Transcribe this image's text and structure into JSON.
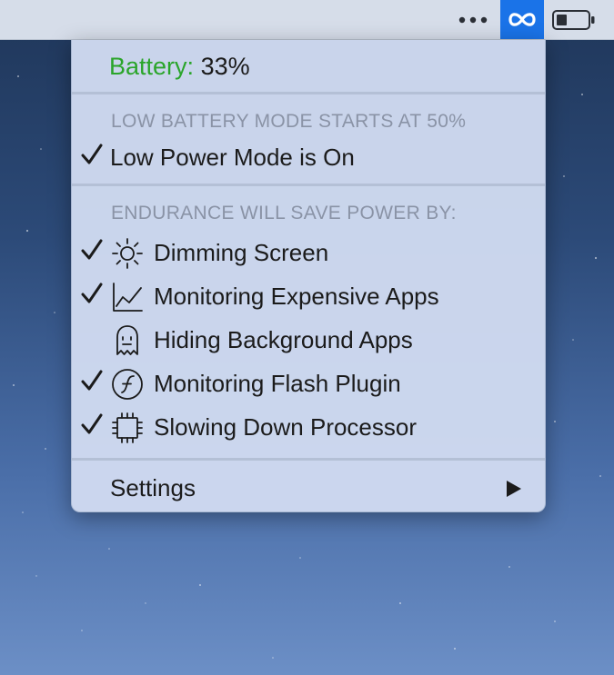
{
  "menubar": {
    "dots_icon": "ellipsis-icon",
    "endurance_icon": "infinity-icon",
    "battery_icon": "battery-icon",
    "accent_color": "#1a73e8"
  },
  "menu": {
    "battery_label": "Battery:",
    "battery_value": "33%",
    "low_battery_header": "LOW BATTERY MODE STARTS AT 50%",
    "low_power_item": {
      "label": "Low Power Mode is On",
      "checked": true
    },
    "savings_header": "ENDURANCE WILL SAVE POWER BY:",
    "items": [
      {
        "label": "Dimming Screen",
        "checked": true,
        "icon": "sun-icon"
      },
      {
        "label": "Monitoring Expensive Apps",
        "checked": true,
        "icon": "chart-line-icon"
      },
      {
        "label": "Hiding Background Apps",
        "checked": false,
        "icon": "ghost-icon"
      },
      {
        "label": "Monitoring Flash Plugin",
        "checked": true,
        "icon": "flash-icon"
      },
      {
        "label": "Slowing Down Processor",
        "checked": true,
        "icon": "cpu-chip-icon"
      }
    ],
    "settings_label": "Settings",
    "settings_arrow_icon": "submenu-arrow-icon"
  }
}
